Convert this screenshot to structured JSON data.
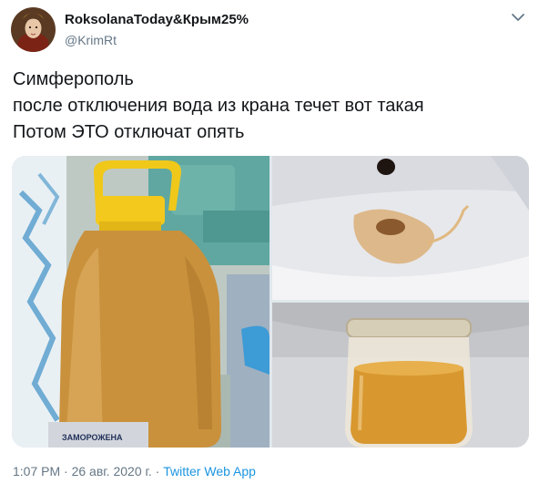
{
  "user": {
    "display_name": "RoksolanaToday&Крым25%",
    "handle": "@KrimRt"
  },
  "tweet": {
    "lines": [
      "Симферополь",
      "после отключения вода из крана течет вот такая",
      "Потом ЭТО отключат опять"
    ]
  },
  "photo1": {
    "bottle_label": "ЗАМОРОЖЕНА"
  },
  "meta": {
    "time": "1:07 PM",
    "separator1": " · ",
    "date": "26 авг. 2020 г.",
    "separator2": " · ",
    "source": "Twitter Web App"
  },
  "colors": {
    "link": "#1b95e0",
    "secondary_text": "#657786",
    "primary_text": "#14171a",
    "water": "#c9923f"
  }
}
